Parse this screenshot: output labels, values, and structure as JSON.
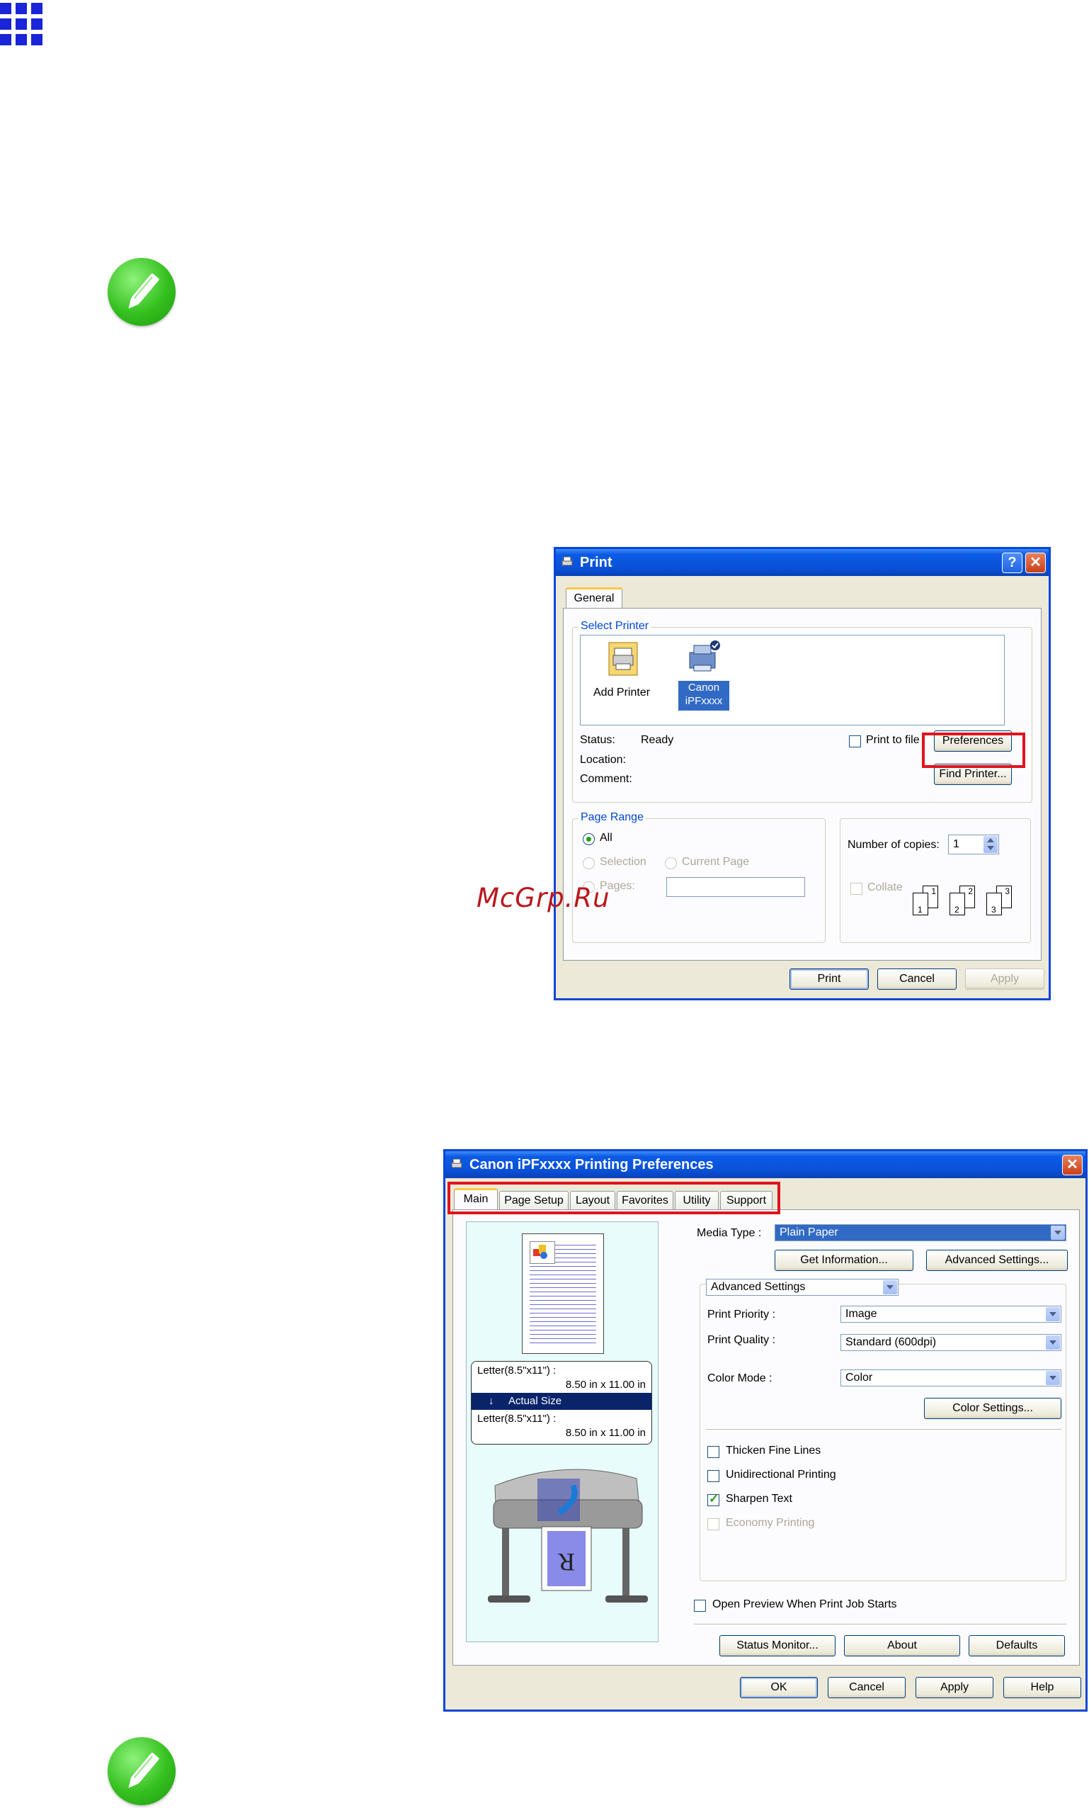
{
  "print_dialog": {
    "title": "Print",
    "tab": "General",
    "select_printer_label": "Select Printer",
    "printers": [
      "Add Printer",
      "Canon iPFxxxx"
    ],
    "printer_canon_line1": "Canon",
    "printer_canon_line2": "iPFxxxx",
    "status_label": "Status:",
    "status_value": "Ready",
    "location_label": "Location:",
    "comment_label": "Comment:",
    "print_to_file": "Print to file",
    "preferences": "Preferences",
    "find_printer": "Find Printer...",
    "page_range_label": "Page Range",
    "all": "All",
    "selection": "Selection",
    "current_page": "Current Page",
    "pages": "Pages:",
    "copies_label": "Number of copies:",
    "copies_value": "1",
    "collate": "Collate",
    "collate_numbers": [
      "1",
      "1",
      "2",
      "2",
      "3",
      "3"
    ],
    "print_button": "Print",
    "cancel_button": "Cancel",
    "apply_button": "Apply"
  },
  "prefs_dialog": {
    "title": "Canon iPFxxxx Printing Preferences",
    "tabs": [
      "Main",
      "Page Setup",
      "Layout",
      "Favorites",
      "Utility",
      "Support"
    ],
    "paper_top_line1": "Letter(8.5\"x11\") :",
    "paper_top_line2": "8.50 in x 11.00 in",
    "actual_size": "Actual Size",
    "paper_bottom_line1": "Letter(8.5\"x11\") :",
    "paper_bottom_line2": "8.50 in x 11.00 in",
    "printer_letter": "R",
    "media_type_label": "Media Type :",
    "media_type_value": "Plain Paper",
    "get_information": "Get Information...",
    "advanced_settings_button": "Advanced Settings...",
    "mode_combo": "Advanced Settings",
    "print_priority_label": "Print Priority :",
    "print_priority_value": "Image",
    "print_quality_label": "Print Quality :",
    "print_quality_value": "Standard (600dpi)",
    "color_mode_label": "Color Mode :",
    "color_mode_value": "Color",
    "color_settings": "Color Settings...",
    "thicken_fine_lines": "Thicken Fine Lines",
    "unidirectional_printing": "Unidirectional Printing",
    "sharpen_text": "Sharpen Text",
    "economy_printing": "Economy Printing",
    "open_preview": "Open Preview When Print Job Starts",
    "status_monitor": "Status Monitor...",
    "about": "About",
    "defaults": "Defaults",
    "ok": "OK",
    "cancel": "Cancel",
    "apply": "Apply",
    "help": "Help"
  },
  "watermark": "McGrp.Ru",
  "colors": {
    "xp_blue": "#0a46d8",
    "note_green": "#34c01e",
    "highlight_red": "#e0141e",
    "grid_blue": "#1a24d8"
  },
  "icons": [
    "grid-menu-icon",
    "note-pencil-icon",
    "add-printer-icon",
    "printer-icon"
  ]
}
